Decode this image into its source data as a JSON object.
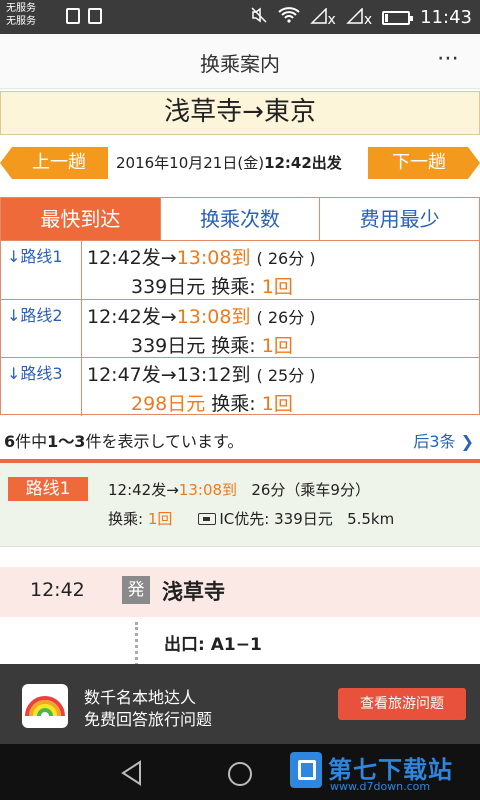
{
  "status_bar": {
    "carrier_line1": "无服务",
    "carrier_line2": "无服务",
    "time": "11:43",
    "signal_x1": "x",
    "signal_x2": "x"
  },
  "header": {
    "title": "换乘案内",
    "more_icon": "⋯"
  },
  "route_header": "浅草寺→東京",
  "date_bar": {
    "prev_label": "上一趟",
    "next_label": "下一趟",
    "date": "2016年10月21日(金)",
    "time_label": "12:42出发"
  },
  "tabs": [
    {
      "label": "最快到达",
      "active": true
    },
    {
      "label": "换乘次数",
      "active": false
    },
    {
      "label": "费用最少",
      "active": false
    }
  ],
  "routes": [
    {
      "label": "↓路线1",
      "depart": "12:42发→",
      "arrive": "13:08到",
      "duration": "( 26分 )",
      "price": "339日元",
      "transfer_label": " 换乘: ",
      "transfers": "1回",
      "price_highlight": false,
      "arrive_highlight": true
    },
    {
      "label": "↓路线2",
      "depart": "12:42发→",
      "arrive": "13:08到",
      "duration": "( 26分 )",
      "price": "339日元",
      "transfer_label": " 换乘: ",
      "transfers": "1回",
      "price_highlight": false,
      "arrive_highlight": true
    },
    {
      "label": "↓路线3",
      "depart": "12:47发→",
      "arrive": "13:12到",
      "duration": "( 25分 )",
      "price": "298日元",
      "transfer_label": " 换乘: ",
      "transfers": "1回",
      "price_highlight": true,
      "arrive_highlight": false
    }
  ],
  "info": {
    "total": "6",
    "range": "1～3",
    "text_a": "件中",
    "text_b": "件を表示しています。",
    "more_label": "后3条 ❯"
  },
  "detail": {
    "badge": "路线1",
    "depart": "12:42发→",
    "arrive": "13:08到",
    "duration": "26分（乘车9分）",
    "transfer_label": "换乘: ",
    "transfers": "1回",
    "ic_label": "IC优先: ",
    "fare": "339日元",
    "distance": "5.5km"
  },
  "station": {
    "time": "12:42",
    "dep_badge": "発",
    "name": "浅草寺",
    "exit": "出口: A1−1"
  },
  "ad": {
    "line1": "数千名本地达人",
    "line2": "免费回答旅行问题",
    "button": "查看旅游问题"
  },
  "watermark": {
    "title": "第七下载站",
    "url": "www.d7down.com"
  },
  "colors": {
    "accent": "#ef6a3a",
    "link": "#2a62b8",
    "orange_button": "#f39a1e"
  }
}
